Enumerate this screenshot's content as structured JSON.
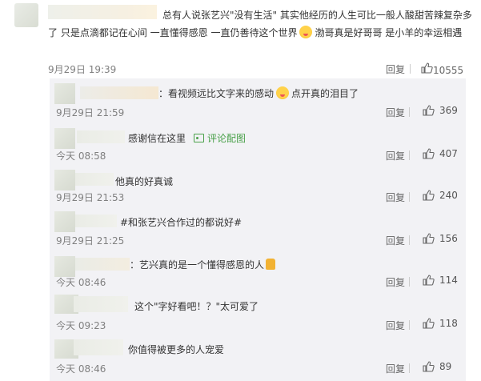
{
  "main": {
    "text": "总有人说张艺兴\"没有生活\" 其实他经历的人生可比一般人酸甜苦辣复杂多了 只是点滴都记在心间 一直懂得感恩 一直仍善待这个世界 渤哥真是好哥哥 是小羊的幸运相遇",
    "text_before_emoji": "总有人说张艺兴\"没有生活\" 其实他经历的人生可比一般人酸甜苦辣复杂多了 只是点滴都记在心间 一直懂得感恩 一直仍善待这个世界",
    "text_after_emoji": "渤哥真是好哥哥 是小羊的幸运相遇",
    "time": "9月29日 19:39",
    "reply_label": "回复",
    "likes": "10555"
  },
  "replies": [
    {
      "text_before": "：看视频远比文字来的感动",
      "text_after": "点开真的泪目了",
      "time": "9月29日 21:59",
      "reply_label": "回复",
      "likes": "369"
    },
    {
      "text": "感谢信在这里",
      "link_label": "评论配图",
      "time": "今天 08:58",
      "reply_label": "回复",
      "likes": "407"
    },
    {
      "text": "他真的好真诚",
      "time": "9月29日 21:53",
      "reply_label": "回复",
      "likes": "240"
    },
    {
      "topic": "#和张艺兴合作过的都说好#",
      "time": "9月29日 21:25",
      "reply_label": "回复",
      "likes": "156"
    },
    {
      "text": "：艺兴真的是一个懂得感恩的人",
      "time": "今天 08:46",
      "reply_label": "回复",
      "likes": "114"
    },
    {
      "text": "这个\"字好看吧！？\"太可爱了",
      "time": "今天 09:23",
      "reply_label": "回复",
      "likes": "118"
    },
    {
      "text": "你值得被更多的人宠爱",
      "time": "今天 08:46",
      "reply_label": "回复",
      "likes": "89"
    }
  ],
  "icons": {
    "like": "thumbs-up-icon",
    "emoji": "smiley-emoji-icon",
    "image": "image-icon"
  },
  "colors": {
    "link": "#3a7ec7",
    "topic": "#4aa14a",
    "panel_bg": "#f2f2f5",
    "meta": "#808080"
  }
}
